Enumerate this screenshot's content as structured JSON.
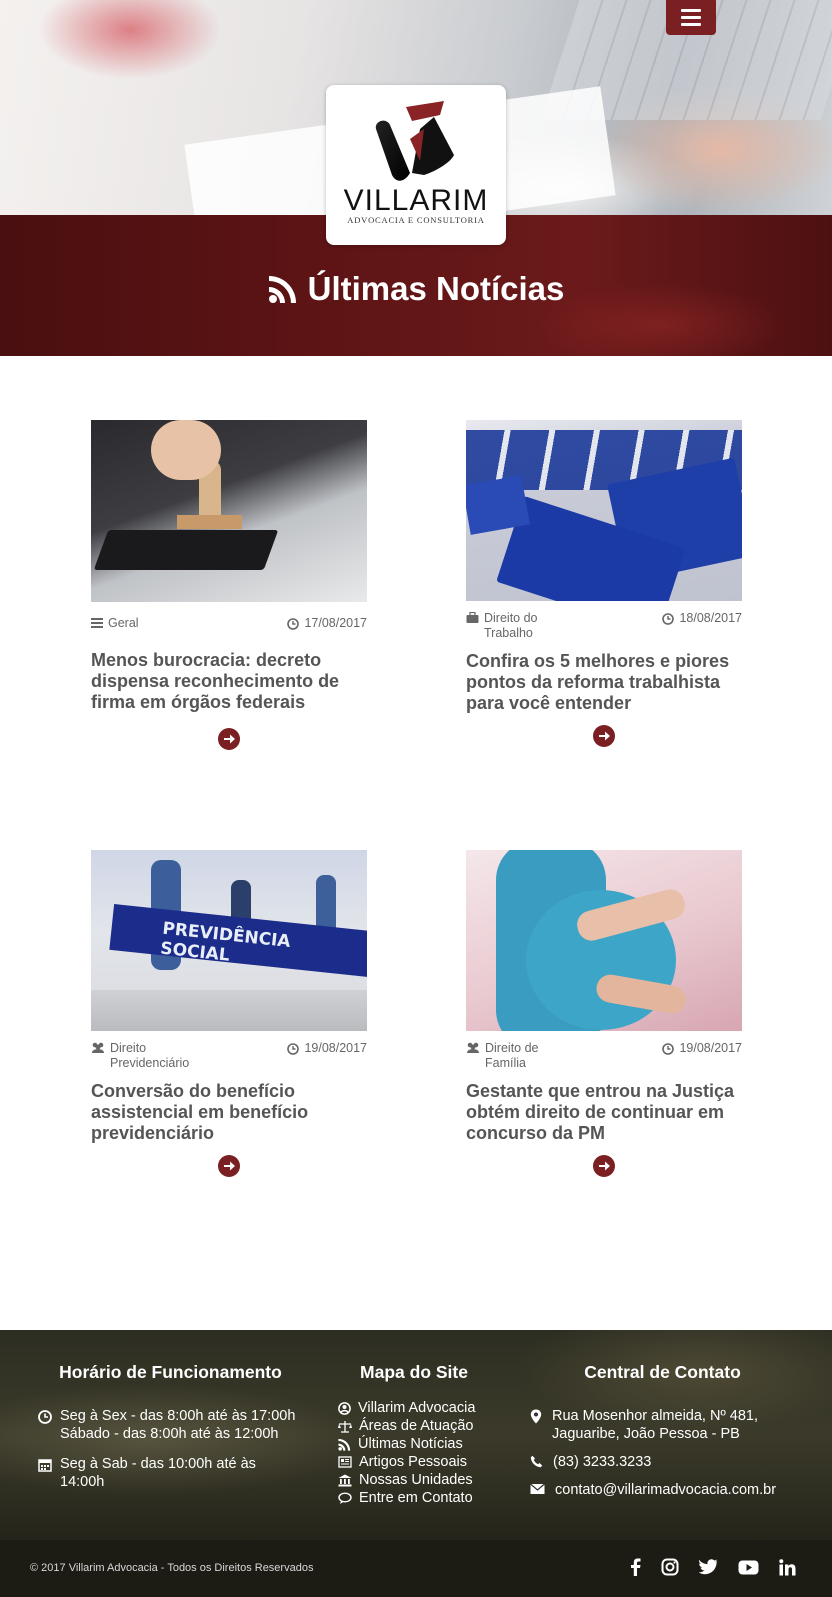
{
  "header": {
    "menu_icon": "hamburger-menu-icon",
    "logo": {
      "name": "VILLARIM",
      "subtitle": "ADVOCACIA E CONSULTORIA"
    },
    "page_title": "Últimas Notícias",
    "title_icon": "rss-icon"
  },
  "news": [
    {
      "category": "Geral",
      "category_icon": "list-icon",
      "date": "17/08/2017",
      "title": "Menos burocracia: decreto dispensa reconhecimento de firma em órgãos federais"
    },
    {
      "category": "Direito do Trabalho",
      "category_icon": "briefcase-icon",
      "date": "18/08/2017",
      "title": "Confira os 5 melhores e piores pontos da reforma trabalhista para você entender"
    },
    {
      "category": "Direito Previdenciário",
      "category_icon": "users-icon",
      "date": "19/08/2017",
      "title": "Conversão do benefício assistencial em benefício previdenciário"
    },
    {
      "category": "Direito de Família",
      "category_icon": "users-icon",
      "date": "19/08/2017",
      "title": "Gestante que entrou na Justiça obtém direito de continuar em concurso da PM"
    }
  ],
  "footer": {
    "hours": {
      "heading": "Horário de Funcionamento",
      "line1a": "Seg à Sex - das 8:00h até às 17:00h",
      "line1b": "Sábado - das 8:00h até às 12:00h",
      "line2": "Seg à Sab - das 10:00h até às 14:00h"
    },
    "sitemap": {
      "heading": "Mapa do Site",
      "items": [
        {
          "label": "Villarim Advocacia",
          "icon": "user-circle-icon"
        },
        {
          "label": "Áreas de Atuação",
          "icon": "scales-icon"
        },
        {
          "label": "Últimas Notícias",
          "icon": "rss-icon"
        },
        {
          "label": "Artigos Pessoais",
          "icon": "newspaper-icon"
        },
        {
          "label": "Nossas Unidades",
          "icon": "bank-icon"
        },
        {
          "label": "Entre em Contato",
          "icon": "chat-icon"
        }
      ]
    },
    "contact": {
      "heading": "Central de Contato",
      "address": "Rua Mosenhor almeida, Nº 481, Jaguaribe, João Pessoa - PB",
      "phone": "(83) 3233.3233",
      "email": "contato@villarimadvocacia.com.br"
    },
    "copyright": "© 2017 Villarim Advocacia - Todos os Direitos Reservados",
    "socials": [
      "facebook-icon",
      "instagram-icon",
      "twitter-icon",
      "youtube-icon",
      "linkedin-icon"
    ]
  },
  "colors": {
    "brand": "#7a1f22",
    "band": "#5e1415",
    "footer": "#2d2e22"
  }
}
